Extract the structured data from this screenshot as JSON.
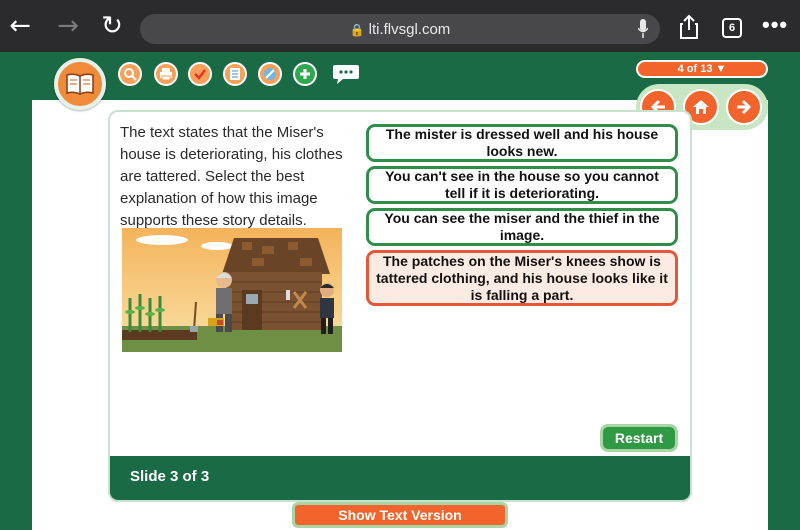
{
  "browser": {
    "url": "lti.flvsgl.com",
    "tab_count": "6",
    "more": "•••"
  },
  "toolbar": {
    "tools": [
      "search-icon",
      "print-icon",
      "check-icon",
      "list-icon",
      "pencil-icon",
      "plus-icon",
      "chat-icon"
    ]
  },
  "navigation": {
    "slide_counter": "4 of 13 ▼"
  },
  "slide": {
    "question": "The text states that the Miser's house is deteriorating, his clothes are tattered. Select the best explanation of how this image supports these story details.",
    "answers": [
      {
        "text": "The mister is dressed well and his house looks new.",
        "selected": false
      },
      {
        "text": "You can't see in the house so you cannot tell if it is deteriorating.",
        "selected": false
      },
      {
        "text": "You can see the miser and the thief in the image.",
        "selected": false
      },
      {
        "text": "The patches on the Miser's knees show is tattered clothing, and his house looks like it is falling a part.",
        "selected": true
      }
    ],
    "restart_label": "Restart",
    "footer": "Slide 3 of 3"
  },
  "show_text_label": "Show Text Version",
  "colors": {
    "brand_green": "#1a6b45",
    "accent_orange": "#f2642b",
    "answer_border": "#2f8f4a",
    "selected_border": "#e4573a"
  }
}
